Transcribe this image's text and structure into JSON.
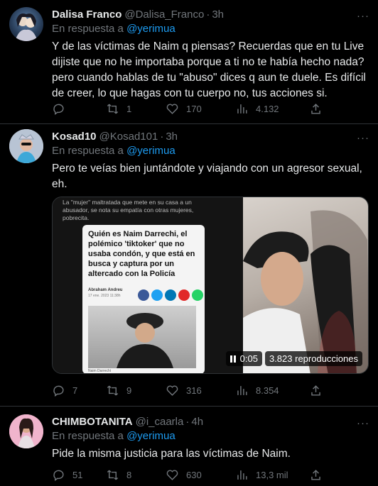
{
  "tweets": [
    {
      "name": "Dalisa Franco",
      "handle": "@Dalisa_Franco",
      "time": "3h",
      "reply_prefix": "En respuesta a",
      "reply_to": "@yerimua",
      "text": "Y de las víctimas de Naim q piensas? Recuerdas que en tu Live dijiste que no he importaba porque a ti no te había hecho nada? pero cuando hablas de tu \"abuso\" dices q aun te duele. Es difícil de creer, lo que hagas con tu cuerpo no, tus acciones si.",
      "retweets": "1",
      "likes": "170",
      "views": "4.132",
      "replies": ""
    },
    {
      "name": "Kosad10",
      "handle": "@Kosad101",
      "time": "3h",
      "reply_prefix": "En respuesta a",
      "reply_to": "@yerimua",
      "text": "Pero te veías bien juntándote y viajando con un agresor sexual, eh.",
      "replies": "7",
      "retweets": "9",
      "likes": "316",
      "views": "8.354"
    },
    {
      "name": "CHIMBOTANITA",
      "handle": "@i_caarla",
      "time": "4h",
      "reply_prefix": "En respuesta a",
      "reply_to": "@yerimua",
      "text": "Pide la misma justicia para las víctimas de Naim.",
      "replies": "51",
      "retweets": "8",
      "likes": "630",
      "views": "13,3 mil"
    }
  ],
  "media": {
    "caption_top": "La \"mujer\" maltratada que mete en su casa a un abusador, se nota su empatía con otras mujeres, pobrecita.",
    "article_title": "Quién es Naim Darrechi, el polémico 'tiktoker' que no usaba condón, y que está en busca y captura por un altercado con la Policía",
    "article_author": "Abraham Andreu",
    "article_date": "17 ene. 2023 11:38h",
    "article_caption": "Naim Darrechi",
    "time": "0:05",
    "views": "3.823 reproducciones"
  },
  "more_label": "···"
}
